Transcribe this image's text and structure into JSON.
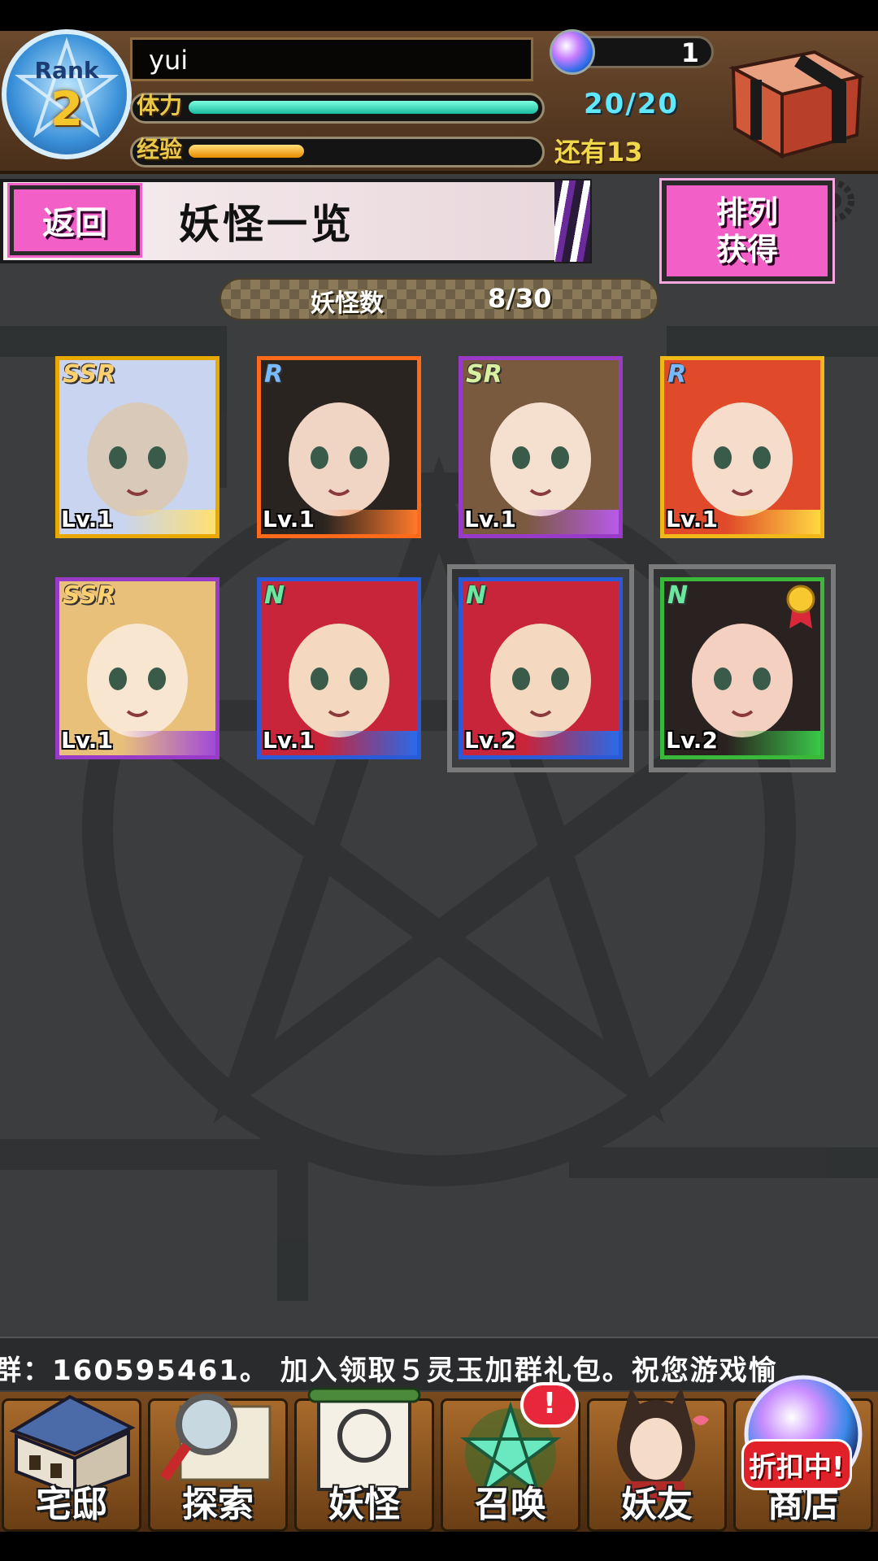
{
  "header": {
    "rank_label": "Rank",
    "rank_value": "2",
    "player_name": "yui",
    "stamina_label": "体力",
    "stamina_value": "20/20",
    "exp_label": "经验",
    "exp_remaining": "还有13",
    "gem_count": "1",
    "stamina_fraction": 1.0,
    "exp_fraction": 0.33
  },
  "title_row": {
    "back_label": "返回",
    "page_title": "妖怪一览",
    "sort_line1": "排列",
    "sort_line2": "获得"
  },
  "count_bar": {
    "label": "妖怪数",
    "value": "8/30"
  },
  "yokai": [
    {
      "rarity": "SSR",
      "level": "Lv.1",
      "frame": "#e8a800",
      "stripe": "#ffe070",
      "face": "#d9c9b8",
      "hair": "#c8d4f0"
    },
    {
      "rarity": "R",
      "level": "Lv.1",
      "frame": "#ff6a1a",
      "stripe": "#ff7a2a",
      "face": "#f0d4c4",
      "hair": "#2a2420"
    },
    {
      "rarity": "SR",
      "level": "Lv.1",
      "frame": "#9a3ac8",
      "stripe": "#b85ae8",
      "face": "#f5e0d0",
      "hair": "#7a5a3e"
    },
    {
      "rarity": "R",
      "level": "Lv.1",
      "frame": "#f0b818",
      "stripe": "#ffd840",
      "face": "#f6dccb",
      "hair": "#e04a2a"
    },
    {
      "rarity": "SSR",
      "level": "Lv.1",
      "frame": "#9a3ac8",
      "stripe": "#a04ad8",
      "face": "#f8e6d0",
      "hair": "#e8c07a"
    },
    {
      "rarity": "N",
      "level": "Lv.1",
      "frame": "#2a5ad8",
      "stripe": "#2a6ae8",
      "face": "#f5d8c0",
      "hair": "#c8243a"
    },
    {
      "rarity": "N",
      "level": "Lv.2",
      "frame": "#2a5ad8",
      "stripe": "#2a6ae8",
      "face": "#f5d8c0",
      "hair": "#c8243a"
    },
    {
      "rarity": "N",
      "level": "Lv.2",
      "frame": "#3ab83a",
      "stripe": "#38c848",
      "face": "#f3d0c0",
      "hair": "#2a2220"
    }
  ],
  "ticker": "群：160595461。  加入领取５灵玉加群礼包。祝您游戏愉",
  "nav": [
    {
      "label": "宅邸",
      "icon": "house-icon"
    },
    {
      "label": "探索",
      "icon": "magnifier-map-icon"
    },
    {
      "label": "妖怪",
      "icon": "scroll-icon"
    },
    {
      "label": "召唤",
      "icon": "pentagram-icon"
    },
    {
      "label": "妖友",
      "icon": "fox-girl-icon"
    },
    {
      "label": "商店",
      "icon": "crystal-orb-icon"
    }
  ],
  "notif_badge": "!",
  "sale_badge": "折扣中!"
}
